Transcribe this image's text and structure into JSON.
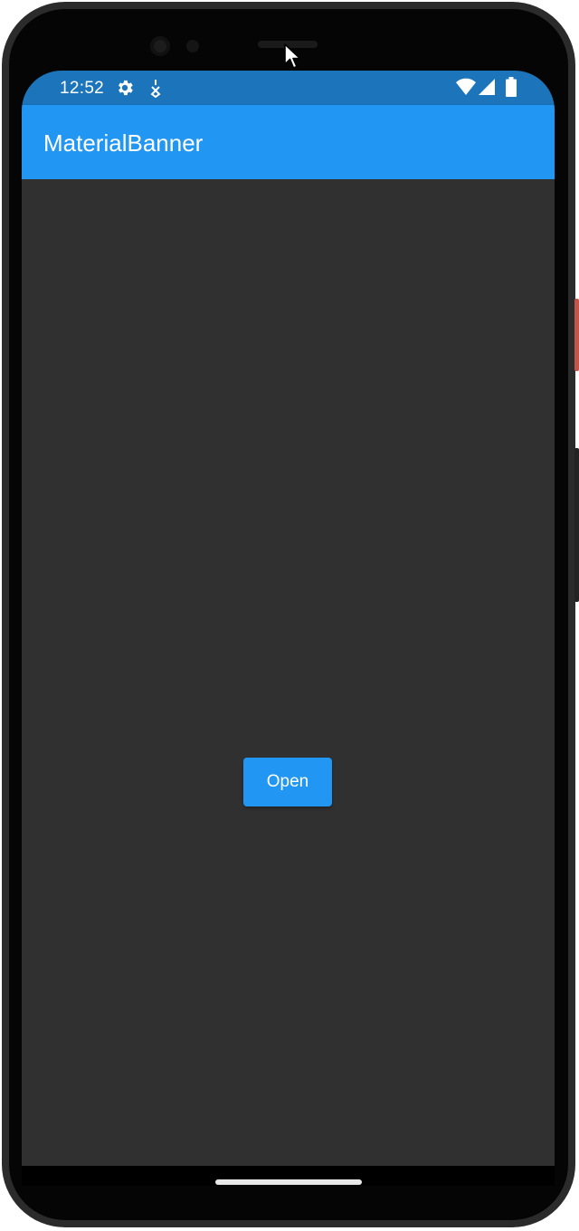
{
  "status_bar": {
    "time": "12:52",
    "icons": [
      "gear-icon",
      "location-icon",
      "wifi-icon",
      "signal-icon",
      "battery-icon"
    ]
  },
  "app_bar": {
    "title": "MaterialBanner",
    "color": "#2196f3"
  },
  "main": {
    "open_button_label": "Open",
    "background": "#303030"
  },
  "colors": {
    "status_bar": "#1c74bb",
    "accent": "#2196f3"
  }
}
